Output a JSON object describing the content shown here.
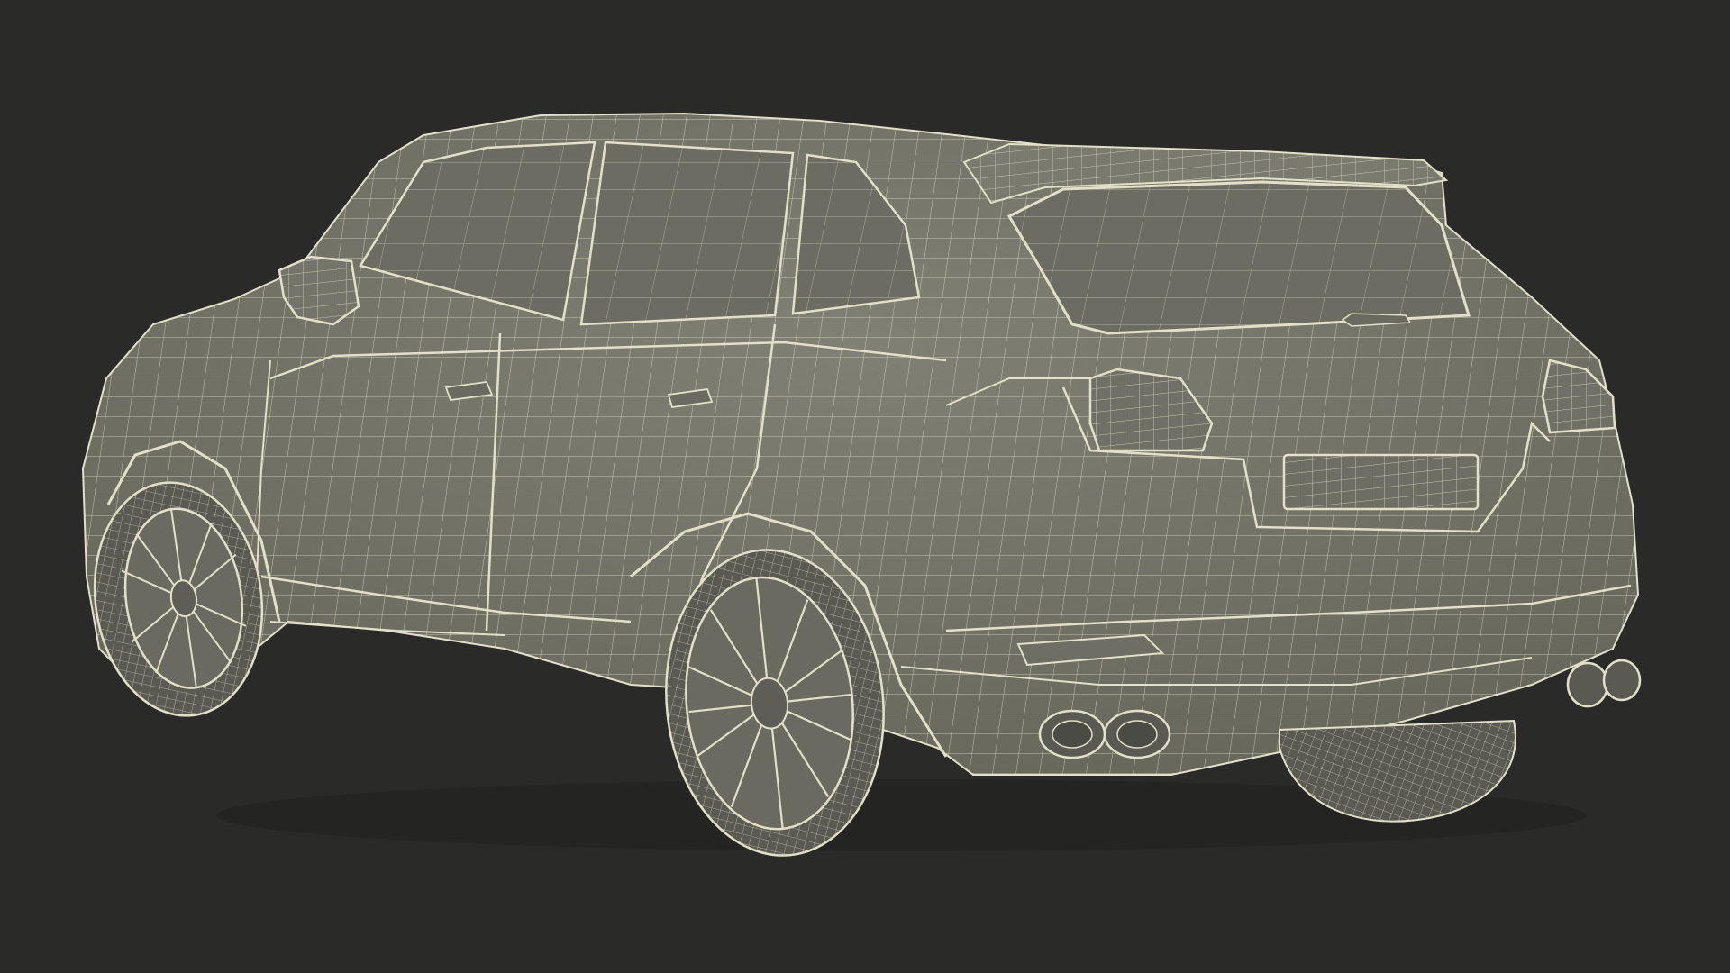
{
  "scene": {
    "subject_icon": "suv-wireframe-icon",
    "colors": {
      "background": "#2a2a29",
      "surface": "#76766a",
      "surface_dark": "#5f5f55",
      "glass": "#6c6c62",
      "wire": "#e2e0c8",
      "wire_faint": "#cfcdb4",
      "tire": "#5a5a52"
    }
  }
}
